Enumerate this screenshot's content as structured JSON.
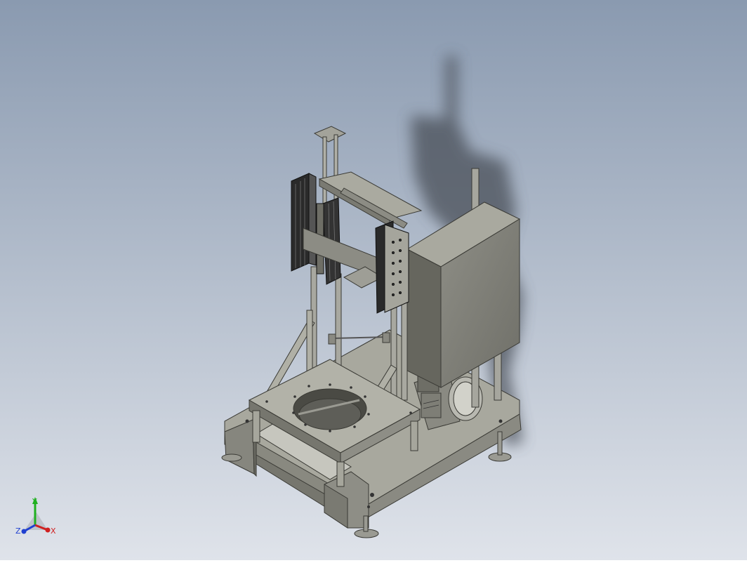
{
  "viewport": {
    "background_top": "#8a9ab0",
    "background_bottom": "#dfe3ea",
    "model_color": "#9a9a8e",
    "model_dark": "#5e5e56",
    "rail_color": "#2a2a2a",
    "shadow_color": "#4a5058"
  },
  "triad": {
    "x_label": "X",
    "y_label": "Y",
    "z_label": "Z",
    "x_color": "#d02020",
    "y_color": "#20b020",
    "z_color": "#2040d0"
  }
}
